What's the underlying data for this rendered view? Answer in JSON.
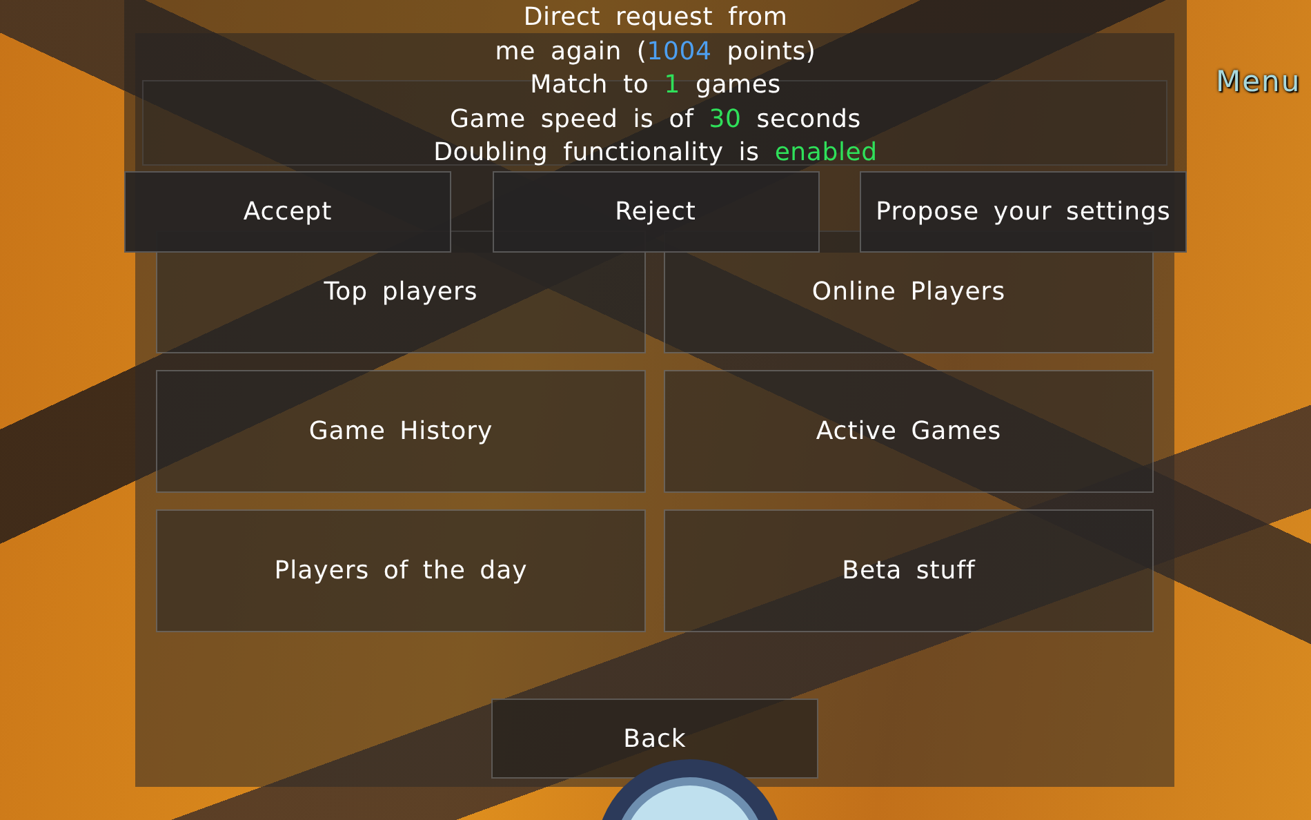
{
  "menu_label": "Menu",
  "lobby_buttons": [
    {
      "label": "Top players"
    },
    {
      "label": "Online Players"
    },
    {
      "label": "Game History"
    },
    {
      "label": "Active Games"
    },
    {
      "label": "Players of the day"
    },
    {
      "label": "Beta stuff"
    }
  ],
  "back_button": "Back",
  "request_dialog": {
    "lines": [
      [
        {
          "text": "Direct request from",
          "kind": "plain"
        }
      ],
      [
        {
          "text": "me again (",
          "kind": "plain"
        },
        {
          "text": "1004",
          "kind": "points"
        },
        {
          "text": " points)",
          "kind": "plain"
        }
      ],
      [
        {
          "text": "Match to ",
          "kind": "plain"
        },
        {
          "text": "1",
          "kind": "value"
        },
        {
          "text": " games",
          "kind": "plain"
        }
      ],
      [
        {
          "text": "Game speed is of ",
          "kind": "plain"
        },
        {
          "text": "30",
          "kind": "value"
        },
        {
          "text": " seconds",
          "kind": "plain"
        }
      ],
      [
        {
          "text": "Doubling functionality is ",
          "kind": "plain"
        },
        {
          "text": "enabled",
          "kind": "value"
        }
      ]
    ],
    "buttons": [
      "Accept",
      "Reject",
      "Propose your settings"
    ]
  }
}
